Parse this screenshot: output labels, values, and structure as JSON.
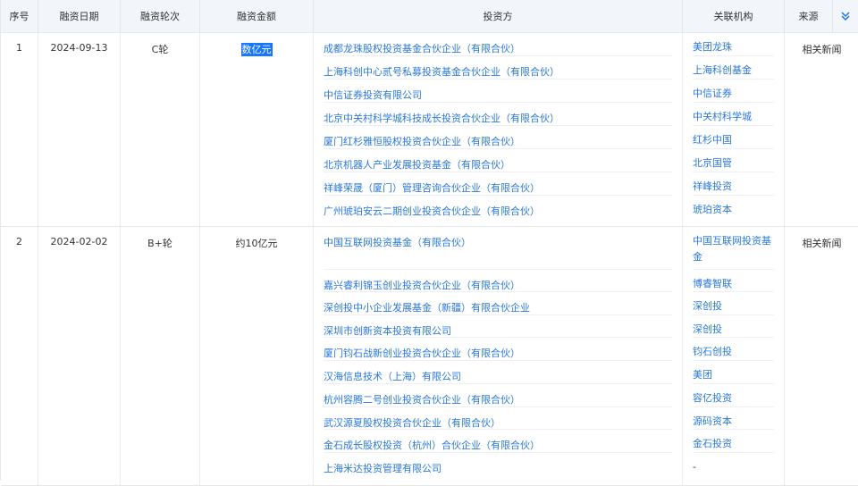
{
  "headers": {
    "index": "序号",
    "date": "融资日期",
    "round": "融资轮次",
    "amount": "融资金额",
    "investors": "投资方",
    "related": "关联机构",
    "source": "来源"
  },
  "rows": [
    {
      "index": "1",
      "date": "2024-09-13",
      "round": "C轮",
      "amount": "数亿元",
      "source": "相关新闻",
      "investors": [
        {
          "name": "成都龙珠股权投资基金合伙企业（有限合伙）",
          "related": "美团龙珠"
        },
        {
          "name": "上海科创中心贰号私募投资基金合伙企业（有限合伙）",
          "related": "上海科创基金"
        },
        {
          "name": "中信证券投资有限公司",
          "related": "中信证券"
        },
        {
          "name": "北京中关村科学城科技成长投资合伙企业（有限合伙）",
          "related": "中关村科学城"
        },
        {
          "name": "厦门红杉雅恒股权投资合伙企业（有限合伙）",
          "related": "红杉中国"
        },
        {
          "name": "北京机器人产业发展投资基金（有限合伙）",
          "related": "北京国管"
        },
        {
          "name": "祥峰荣晟（厦门）管理咨询合伙企业（有限合伙）",
          "related": "祥峰投资"
        },
        {
          "name": "广州琥珀安云二期创业投资合伙企业（有限合伙）",
          "related": "琥珀资本"
        }
      ]
    },
    {
      "index": "2",
      "date": "2024-02-02",
      "round": "B+轮",
      "amount": "约10亿元",
      "source": "相关新闻",
      "investors": [
        {
          "name": "中国互联网投资基金（有限合伙）",
          "related": "中国互联网投资基",
          "related2": "金"
        },
        {
          "name": "嘉兴睿利锦玉创业投资合伙企业（有限合伙）",
          "related": "博睿智联"
        },
        {
          "name": "深创投中小企业发展基金（新疆）有限合伙企业",
          "related": "深创投"
        },
        {
          "name": "深圳市创新资本投资有限公司",
          "related": "深创投"
        },
        {
          "name": "厦门钧石战新创业投资合伙企业（有限合伙）",
          "related": "钧石创投"
        },
        {
          "name": "汉海信息技术（上海）有限公司",
          "related": "美团"
        },
        {
          "name": "杭州容腾二号创业投资合伙企业（有限合伙）",
          "related": "容亿投资"
        },
        {
          "name": "武汉源夏股权投资合伙企业（有限合伙）",
          "related": "源码资本"
        },
        {
          "name": "金石成长股权投资（杭州）合伙企业（有限合伙）",
          "related": "金石投资"
        },
        {
          "name": "上海米达投资管理有限公司",
          "related": "-"
        }
      ]
    }
  ],
  "icons": {
    "collapse": "double-chevron-down-icon"
  }
}
